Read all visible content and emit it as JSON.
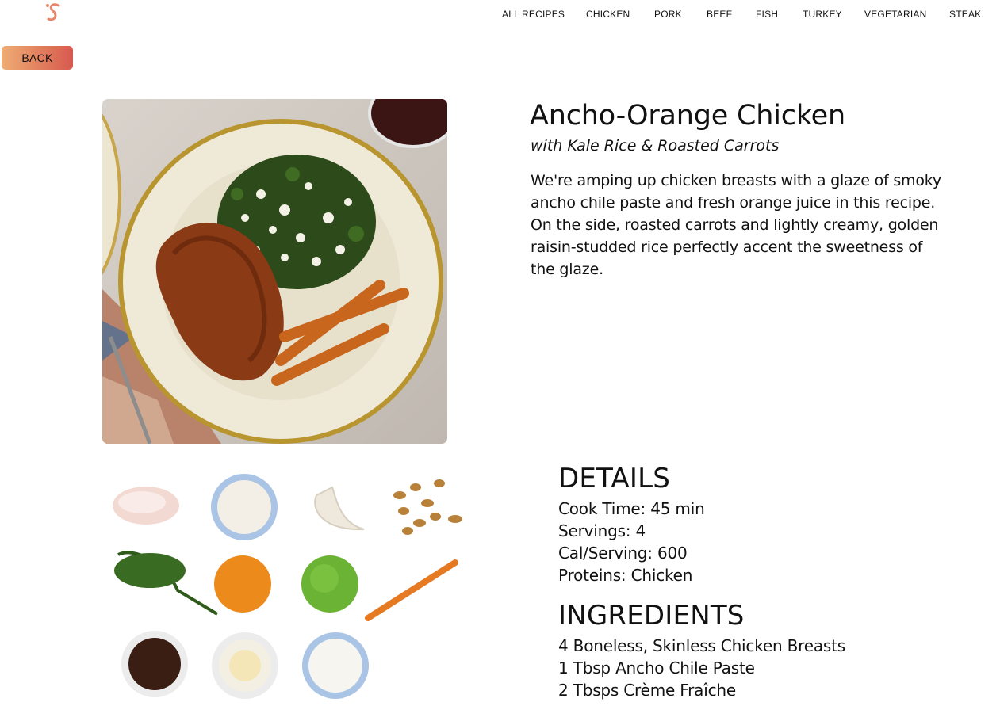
{
  "nav": {
    "items": [
      "ALL RECIPES",
      "CHICKEN",
      "PORK",
      "BEEF",
      "FISH",
      "TURKEY",
      "VEGETARIAN",
      "STEAK"
    ]
  },
  "back_label": "BACK",
  "brand_color": "#e8866a",
  "recipe": {
    "title": "Ancho-Orange Chicken",
    "subtitle": "with Kale Rice & Roasted Carrots",
    "description": "We're amping up chicken breasts with a glaze of smoky ancho chile paste and fresh orange juice in this recipe. On the side, roasted carrots and lightly creamy, golden raisin-studded rice perfectly accent the sweetness of the glaze."
  },
  "details": {
    "heading": "DETAILS",
    "cook_time": "Cook Time: 45 min",
    "servings": "Servings: 4",
    "calories": "Cal/Serving: 600",
    "proteins": "Proteins: Chicken"
  },
  "ingredients": {
    "heading": "INGREDIENTS",
    "items": [
      "4 Boneless, Skinless Chicken Breasts",
      "1 Tbsp Ancho Chile Paste",
      "2 Tbsps Crème Fraîche"
    ]
  }
}
